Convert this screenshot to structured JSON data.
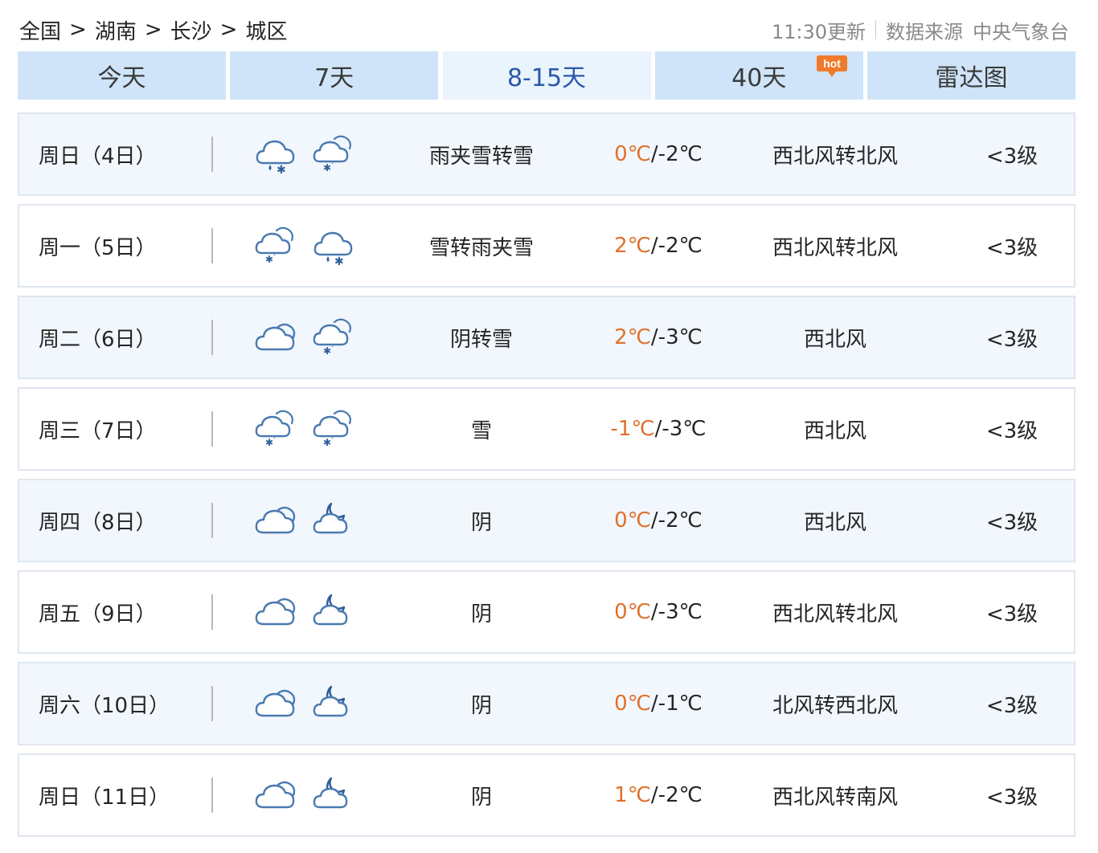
{
  "breadcrumb": [
    "全国",
    "湖南",
    "长沙",
    "城区"
  ],
  "breadcrumb_separator": ">",
  "update": {
    "time": "11:30更新",
    "source_label": "数据来源",
    "source_name": "中央气象台"
  },
  "tabs": [
    {
      "label": "今天",
      "active": false
    },
    {
      "label": "7天",
      "active": false
    },
    {
      "label": "8-15天",
      "active": true
    },
    {
      "label": "40天",
      "active": false,
      "badge": "hot"
    },
    {
      "label": "雷达图",
      "active": false
    }
  ],
  "colors": {
    "tab_bg": "#cfe4f8",
    "tab_active_bg": "#eaf4fd",
    "tab_active_text": "#2b58a8",
    "high_temp": "#e0702c",
    "row_shade": "#f1f7fd",
    "hot_badge": "#f07a2a"
  },
  "forecast": [
    {
      "day": "周日（4日）",
      "icons": [
        "sleet-icon",
        "snow-icon"
      ],
      "desc": "雨夹雪转雪",
      "high": "0℃",
      "low": "/-2℃",
      "wind": "西北风转北风",
      "level": "<3级"
    },
    {
      "day": "周一（5日）",
      "icons": [
        "snow-icon",
        "sleet-icon"
      ],
      "desc": "雪转雨夹雪",
      "high": "2℃",
      "low": "/-2℃",
      "wind": "西北风转北风",
      "level": "<3级"
    },
    {
      "day": "周二（6日）",
      "icons": [
        "overcast-icon",
        "snow-icon"
      ],
      "desc": "阴转雪",
      "high": "2℃",
      "low": "/-3℃",
      "wind": "西北风",
      "level": "<3级"
    },
    {
      "day": "周三（7日）",
      "icons": [
        "snow-icon",
        "snow-icon"
      ],
      "desc": "雪",
      "high": "-1℃",
      "low": "/-3℃",
      "wind": "西北风",
      "level": "<3级"
    },
    {
      "day": "周四（8日）",
      "icons": [
        "overcast-icon",
        "cloudy-night-icon"
      ],
      "desc": "阴",
      "high": "0℃",
      "low": "/-2℃",
      "wind": "西北风",
      "level": "<3级"
    },
    {
      "day": "周五（9日）",
      "icons": [
        "overcast-icon",
        "cloudy-night-icon"
      ],
      "desc": "阴",
      "high": "0℃",
      "low": "/-3℃",
      "wind": "西北风转北风",
      "level": "<3级"
    },
    {
      "day": "周六（10日）",
      "icons": [
        "overcast-icon",
        "cloudy-night-icon"
      ],
      "desc": "阴",
      "high": "0℃",
      "low": "/-1℃",
      "wind": "北风转西北风",
      "level": "<3级"
    },
    {
      "day": "周日（11日）",
      "icons": [
        "overcast-icon",
        "cloudy-night-icon"
      ],
      "desc": "阴",
      "high": "1℃",
      "low": "/-2℃",
      "wind": "西北风转南风",
      "level": "<3级"
    }
  ]
}
